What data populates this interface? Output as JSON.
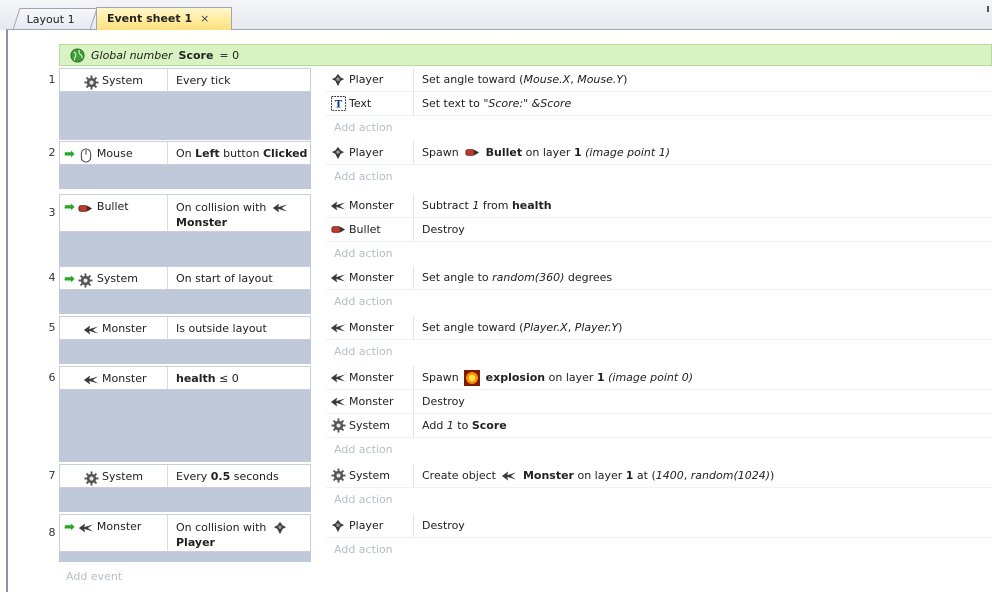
{
  "tabs": [
    {
      "label": "Layout 1",
      "active": false
    },
    {
      "label": "Event sheet 1",
      "active": true,
      "close": "×"
    }
  ],
  "global": {
    "prefix": "Global number",
    "name": "Score",
    "suffix": "= 0"
  },
  "events": [
    {
      "num": "1",
      "trigger": false,
      "obj_icon": "gear-icon",
      "obj": "System",
      "cond": [
        "Every tick"
      ],
      "actions": [
        {
          "icon": "player-icon",
          "obj": "Player",
          "text": [
            "Set angle toward (",
            {
              "i": "Mouse.X"
            },
            ", ",
            {
              "i": "Mouse.Y"
            },
            ")"
          ]
        },
        {
          "icon": "text-icon",
          "obj": "Text",
          "text": [
            "Set text to ",
            {
              "i": "\"Score:\" &Score"
            }
          ]
        }
      ]
    },
    {
      "num": "2",
      "trigger": true,
      "obj_icon": "mouse-icon",
      "obj": "Mouse",
      "cond": [
        "On ",
        {
          "b": "Left"
        },
        " button ",
        {
          "b": "Clicked"
        }
      ],
      "actions": [
        {
          "icon": "player-icon",
          "obj": "Player",
          "text": [
            "Spawn ",
            {
              "icon": "bullet-icon"
            },
            " ",
            {
              "b": "Bullet"
            },
            " on layer ",
            {
              "b": "1"
            },
            " ",
            {
              "i": "(image point 1)"
            }
          ]
        }
      ]
    },
    {
      "num": "3",
      "trigger": true,
      "obj_icon": "bullet-icon",
      "obj": "Bullet",
      "tall": true,
      "cond": [
        "On collision with ",
        {
          "icon": "monster-icon"
        },
        {
          "br": true
        },
        {
          "b": "Monster"
        }
      ],
      "actions": [
        {
          "icon": "monster-icon",
          "obj": "Monster",
          "text": [
            "Subtract ",
            {
              "i": "1"
            },
            " from ",
            {
              "b": "health"
            }
          ]
        },
        {
          "icon": "bullet-icon",
          "obj": "Bullet",
          "text": [
            "Destroy"
          ]
        }
      ]
    },
    {
      "num": "4",
      "trigger": true,
      "obj_icon": "gear-icon",
      "obj": "System",
      "cond": [
        "On start of layout"
      ],
      "actions": [
        {
          "icon": "monster-icon",
          "obj": "Monster",
          "text": [
            "Set angle to ",
            {
              "i": "random(360)"
            },
            " degrees"
          ]
        }
      ]
    },
    {
      "num": "5",
      "trigger": false,
      "obj_icon": "monster-icon",
      "obj": "Monster",
      "cond": [
        "Is outside layout"
      ],
      "actions": [
        {
          "icon": "monster-icon",
          "obj": "Monster",
          "text": [
            "Set angle toward (",
            {
              "i": "Player.X"
            },
            ", ",
            {
              "i": "Player.Y"
            },
            ")"
          ]
        }
      ]
    },
    {
      "num": "6",
      "trigger": false,
      "obj_icon": "monster-icon",
      "obj": "Monster",
      "cond": [
        {
          "b": "health"
        },
        " ≤ 0"
      ],
      "actions": [
        {
          "icon": "monster-icon",
          "obj": "Monster",
          "text": [
            "Spawn ",
            {
              "icon": "explosion-icon"
            },
            " ",
            {
              "b": "explosion"
            },
            " on layer ",
            {
              "b": "1"
            },
            " ",
            {
              "i": "(image point 0)"
            }
          ]
        },
        {
          "icon": "monster-icon",
          "obj": "Monster",
          "text": [
            "Destroy"
          ]
        },
        {
          "icon": "gear-icon",
          "obj": "System",
          "text": [
            "Add ",
            {
              "i": "1"
            },
            " to ",
            {
              "b": "Score"
            }
          ]
        }
      ]
    },
    {
      "num": "7",
      "trigger": false,
      "obj_icon": "gear-icon",
      "obj": "System",
      "cond": [
        "Every ",
        {
          "b": "0.5"
        },
        " seconds"
      ],
      "actions": [
        {
          "icon": "gear-icon",
          "obj": "System",
          "text": [
            "Create object ",
            {
              "icon": "monster-icon"
            },
            " ",
            {
              "b": "Monster"
            },
            " on layer ",
            {
              "b": "1"
            },
            " at (",
            {
              "i": "1400"
            },
            ", ",
            {
              "i": "random(1024)"
            },
            ")"
          ]
        }
      ]
    },
    {
      "num": "8",
      "trigger": true,
      "obj_icon": "monster-icon",
      "obj": "Monster",
      "tall": true,
      "cond": [
        "On collision with ",
        {
          "icon": "player-icon"
        },
        {
          "br": true
        },
        {
          "b": "Player"
        }
      ],
      "actions": [
        {
          "icon": "player-icon",
          "obj": "Player",
          "text": [
            "Destroy"
          ]
        }
      ]
    }
  ],
  "add_action_label": "Add action",
  "add_event_label": "Add event",
  "colors": {
    "global_bg": "#d9f2c2",
    "active_tab": "#ffe27d",
    "event_block": "#bfc9d9",
    "trigger_arrow": "#2aa52a"
  }
}
